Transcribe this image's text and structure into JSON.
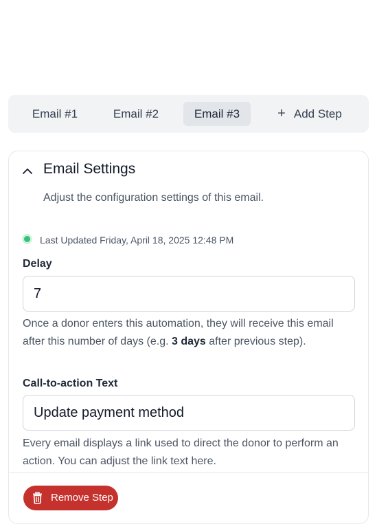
{
  "tabs": [
    {
      "label": "Email #1",
      "active": false
    },
    {
      "label": "Email #2",
      "active": false
    },
    {
      "label": "Email #3",
      "active": true
    }
  ],
  "add_step": {
    "icon": "plus-icon",
    "label": "Add Step"
  },
  "settings": {
    "title": "Email Settings",
    "subtitle": "Adjust the configuration settings of this email.",
    "collapse_icon": "chevron-up-icon",
    "status_color": "#34c27a",
    "last_updated": "Last Updated Friday, April 18, 2025 12:48 PM",
    "delay": {
      "label": "Delay",
      "value": "7",
      "help_before": "Once a donor enters this automation, they will receive this email after this number of days (e.g. ",
      "help_bold": "3 days",
      "help_after": " after previous step)."
    },
    "cta": {
      "label": "Call-to-action Text",
      "value": "Update payment method",
      "help": "Every email displays a link used to direct the donor to perform an action. You can adjust the link text here."
    },
    "remove_button": {
      "icon": "trash-icon",
      "label": "Remove Step",
      "color": "#c5322d"
    }
  }
}
